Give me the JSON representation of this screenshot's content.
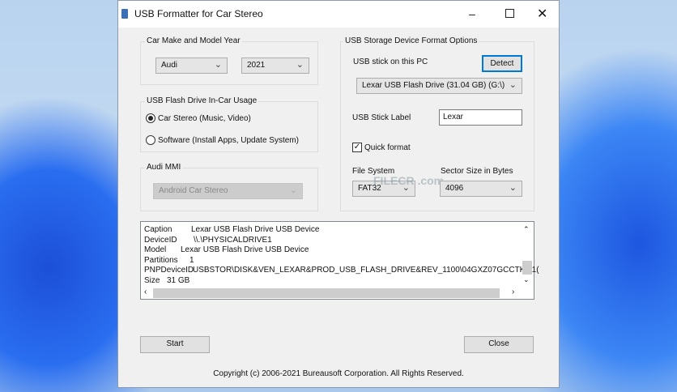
{
  "window": {
    "title": "USB Formatter for Car Stereo"
  },
  "car_group": {
    "label": "Car Make and Model Year",
    "make": "Audi",
    "year": "2021"
  },
  "usage_group": {
    "label": "USB Flash Drive In-Car Usage",
    "options": [
      {
        "label": "Car Stereo (Music, Video)",
        "selected": true
      },
      {
        "label": "Software (Install Apps, Update System)",
        "selected": false
      }
    ]
  },
  "mmi_group": {
    "label": "Audi MMI",
    "value": "Android Car Stereo"
  },
  "usb_group": {
    "label": "USB Storage Device Format Options",
    "stick_label": "USB stick on this PC",
    "detect": "Detect",
    "device": "Lexar USB Flash Drive (31.04 GB) (G:\\)",
    "label_caption": "USB Stick Label",
    "label_value": "Lexar",
    "quick_format": "Quick format",
    "quick_format_checked": true,
    "fs_caption": "File System",
    "fs_value": "FAT32",
    "sector_caption": "Sector Size in Bytes",
    "sector_value": "4096"
  },
  "info": [
    {
      "key": "Caption",
      "value": "Lexar USB Flash Drive USB Device"
    },
    {
      "key": "DeviceID",
      "value": "\\\\.\\PHYSICALDRIVE1"
    },
    {
      "key": "Model",
      "value": "Lexar USB Flash Drive USB Device"
    },
    {
      "key": "Partitions",
      "value": "1"
    },
    {
      "key": "PNPDeviceID",
      "value": "USBSTOR\\DISK&VEN_LEXAR&PROD_USB_FLASH_DRIVE&REV_1100\\04GXZ07GCCTK7I1("
    },
    {
      "key": "Size",
      "value": "31 GB"
    }
  ],
  "buttons": {
    "start": "Start",
    "close": "Close"
  },
  "copyright": "Copyright (c) 2006-2021 Bureausoft Corporation. All Rights Reserved.",
  "watermark": "FILECR .com"
}
